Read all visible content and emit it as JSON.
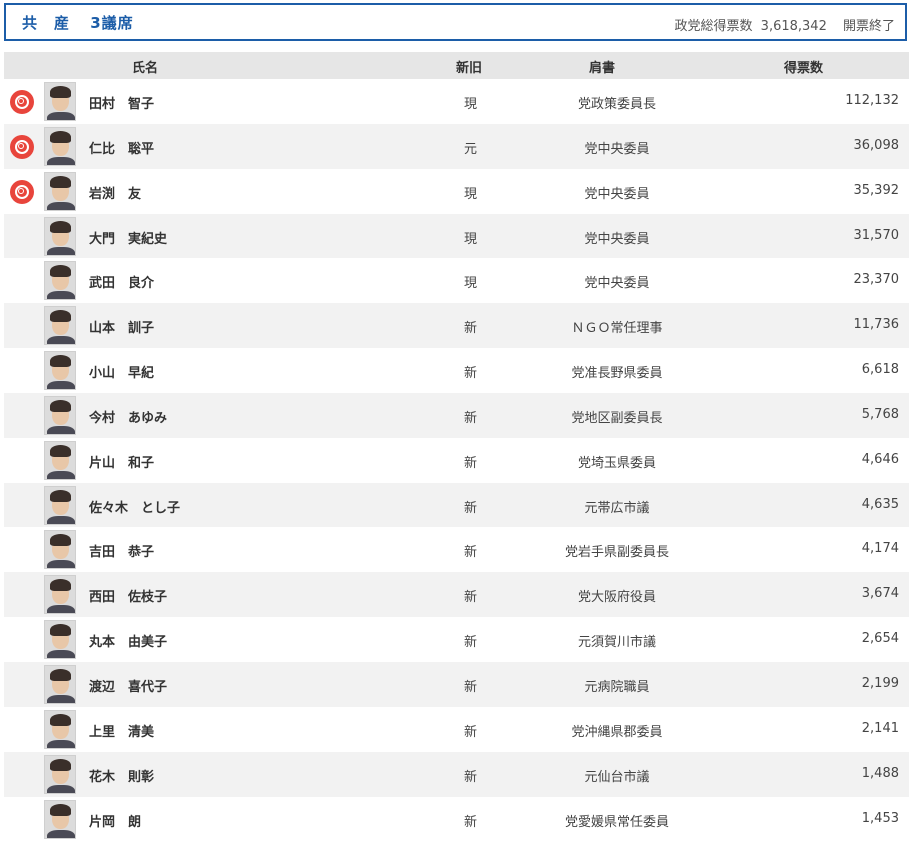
{
  "header": {
    "party": "共　産",
    "seats": "3議席",
    "total_label": "政党総得票数",
    "total_votes": "3,618,342",
    "status": "開票終了"
  },
  "columns": {
    "name": "氏名",
    "new_old": "新旧",
    "title": "肩書",
    "votes": "得票数"
  },
  "colors": {
    "accent": "#1c5da8",
    "elected_badge": "#e8453c",
    "header_bg": "#e6e6e6",
    "alt_row": "#f2f2f2"
  },
  "candidates": [
    {
      "elected": true,
      "name": "田村　智子",
      "status": "現",
      "title": "党政策委員長",
      "votes": "112,132"
    },
    {
      "elected": true,
      "name": "仁比　聡平",
      "status": "元",
      "title": "党中央委員",
      "votes": "36,098"
    },
    {
      "elected": true,
      "name": "岩渕　友",
      "status": "現",
      "title": "党中央委員",
      "votes": "35,392"
    },
    {
      "elected": false,
      "name": "大門　実紀史",
      "status": "現",
      "title": "党中央委員",
      "votes": "31,570"
    },
    {
      "elected": false,
      "name": "武田　良介",
      "status": "現",
      "title": "党中央委員",
      "votes": "23,370"
    },
    {
      "elected": false,
      "name": "山本　訓子",
      "status": "新",
      "title": "ＮＧＯ常任理事",
      "votes": "11,736"
    },
    {
      "elected": false,
      "name": "小山　早紀",
      "status": "新",
      "title": "党准長野県委員",
      "votes": "6,618"
    },
    {
      "elected": false,
      "name": "今村　あゆみ",
      "status": "新",
      "title": "党地区副委員長",
      "votes": "5,768"
    },
    {
      "elected": false,
      "name": "片山　和子",
      "status": "新",
      "title": "党埼玉県委員",
      "votes": "4,646"
    },
    {
      "elected": false,
      "name": "佐々木　とし子",
      "status": "新",
      "title": "元帯広市議",
      "votes": "4,635"
    },
    {
      "elected": false,
      "name": "吉田　恭子",
      "status": "新",
      "title": "党岩手県副委員長",
      "votes": "4,174"
    },
    {
      "elected": false,
      "name": "西田　佐枝子",
      "status": "新",
      "title": "党大阪府役員",
      "votes": "3,674"
    },
    {
      "elected": false,
      "name": "丸本　由美子",
      "status": "新",
      "title": "元須賀川市議",
      "votes": "2,654"
    },
    {
      "elected": false,
      "name": "渡辺　喜代子",
      "status": "新",
      "title": "元病院職員",
      "votes": "2,199"
    },
    {
      "elected": false,
      "name": "上里　清美",
      "status": "新",
      "title": "党沖縄県郡委員",
      "votes": "2,141"
    },
    {
      "elected": false,
      "name": "花木　則彰",
      "status": "新",
      "title": "元仙台市議",
      "votes": "1,488"
    },
    {
      "elected": false,
      "name": "片岡　朗",
      "status": "新",
      "title": "党愛媛県常任委員",
      "votes": "1,453"
    }
  ]
}
